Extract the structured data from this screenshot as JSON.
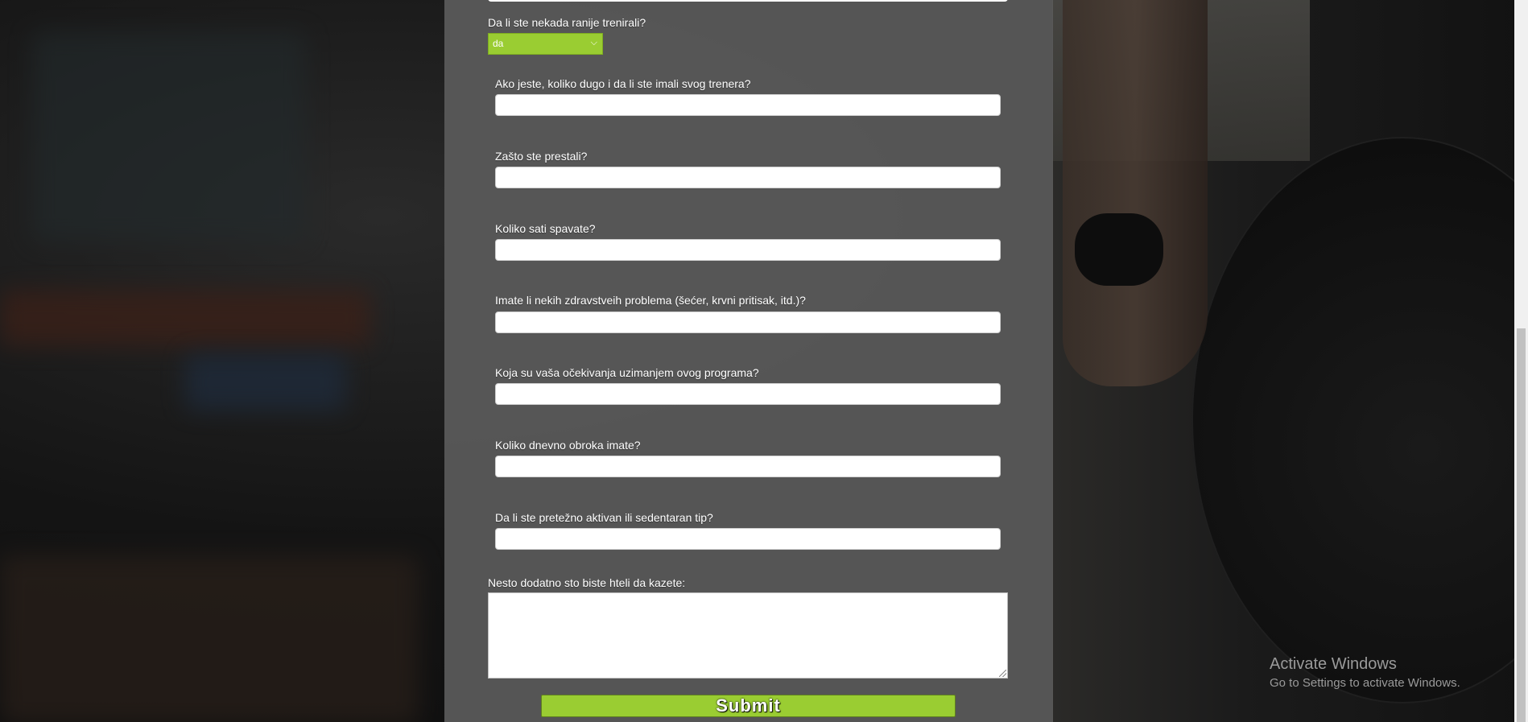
{
  "form": {
    "q_trained_before": {
      "label": "Da li ste nekada ranije trenirali?",
      "selected": "da",
      "chevron": "chevron-down-icon"
    },
    "q_how_long_trainer": {
      "label": "Ako jeste, koliko dugo i da li ste imali svog trenera?",
      "value": ""
    },
    "q_why_stopped": {
      "label": "Zašto ste prestali?",
      "value": ""
    },
    "q_sleep_hours": {
      "label": "Koliko sati spavate?",
      "value": ""
    },
    "q_health_problems": {
      "label": "Imate li nekih zdravstveih problema (šećer, krvni pritisak, itd.)?",
      "value": ""
    },
    "q_expectations": {
      "label": "Koja su vaša očekivanja uzimanjem ovog programa?",
      "value": ""
    },
    "q_meals_per_day": {
      "label": "Koliko dnevno obroka imate?",
      "value": ""
    },
    "q_active_sedentary": {
      "label": "Da li ste pretežno aktivan ili sedentaran tip?",
      "value": ""
    },
    "q_additional": {
      "label": "Nesto dodatno sto biste hteli da kazete:",
      "value": ""
    },
    "submit_label": "Submit"
  },
  "os_watermark": {
    "title": "Activate Windows",
    "subtitle": "Go to Settings to activate Windows."
  },
  "colors": {
    "accent": "#9acd32",
    "panel": "#5a5a5a"
  }
}
